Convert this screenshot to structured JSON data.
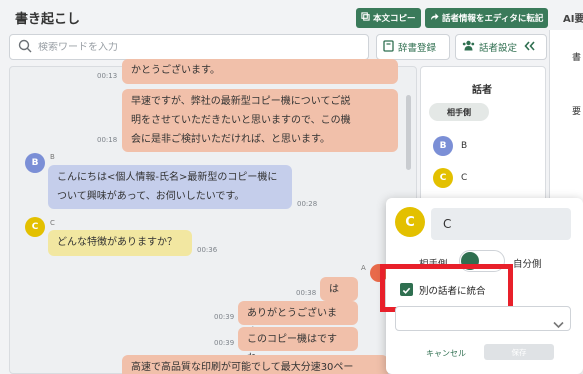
{
  "header": {
    "title": "書き起こし",
    "copy_text_button": "本文コピー",
    "transfer_button": "話者情報をエディタに転記",
    "ai_label": "AI要"
  },
  "search": {
    "placeholder": "検索ワードを入力",
    "dictionary_button": "辞書登録",
    "speaker_settings_button": "話者設定"
  },
  "messages": [
    {
      "speaker": "A",
      "side": "right",
      "text": "かとうございます。",
      "time": "00:13"
    },
    {
      "speaker": "A",
      "side": "right",
      "lines": [
        "早速ですが、弊社の最新型コピー機についてご説",
        "明をさせていただきたいと思いますので、この機",
        "会に是非ご検討いただければ、と思います。"
      ],
      "time": "00:18"
    },
    {
      "speaker": "B",
      "side": "left",
      "lines": [
        "こんにちは<個人情報-氏名>最新型のコピー機に",
        "ついて興味があって、お伺いしたいです。"
      ],
      "time": "00:28"
    },
    {
      "speaker": "C",
      "side": "left",
      "text": "どんな特徴がありますか？",
      "time": "00:36"
    },
    {
      "speaker": "A",
      "side": "right",
      "text": "はい。",
      "time": "00:38"
    },
    {
      "speaker": "A",
      "side": "right",
      "text": "ありがとうございます。",
      "time": "00:39"
    },
    {
      "speaker": "A",
      "side": "right",
      "text": "このコピー機はですね。",
      "time": "00:39"
    },
    {
      "speaker": "A",
      "side": "right",
      "text": "高速で高品質な印刷が可能でして最大分速30ペー",
      "time": ""
    }
  ],
  "speaker_panel": {
    "title": "話者",
    "other_party_label": "相手側",
    "speakers": [
      {
        "letter": "B",
        "name": "B"
      },
      {
        "letter": "C",
        "name": "C"
      }
    ]
  },
  "ai_panel": {
    "lines": [
      "書",
      "要"
    ]
  },
  "popup": {
    "avatar_letter": "C",
    "name_value": "C",
    "toggle_left_label": "相手側",
    "toggle_right_label": "自分側",
    "merge_label": "別の話者に統合",
    "merge_checked": true,
    "cancel_label": "キャンセル",
    "save_label": "保存"
  },
  "colors": {
    "accent_green": "#3a7a5a",
    "speaker_a": "#f1c0aa",
    "speaker_b": "#c5ceeb",
    "speaker_c": "#f2e7a1",
    "highlight": "#e8202a"
  },
  "icons": [
    "search-icon",
    "copy-icon",
    "share-icon",
    "book-icon",
    "people-icon",
    "double-chevron-left-icon",
    "check-icon",
    "chevron-down-icon"
  ]
}
